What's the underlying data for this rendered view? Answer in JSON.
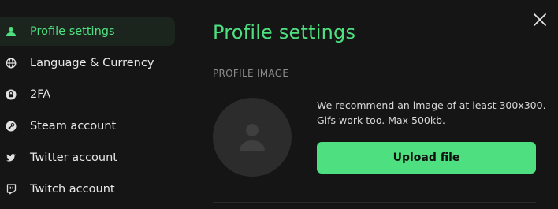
{
  "close": {
    "icon": "close-icon"
  },
  "sidebar": {
    "items": [
      {
        "label": "Profile settings",
        "icon": "user-icon",
        "active": true
      },
      {
        "label": "Language & Currency",
        "icon": "globe-icon",
        "active": false
      },
      {
        "label": "2FA",
        "icon": "lock-icon",
        "active": false
      },
      {
        "label": "Steam account",
        "icon": "steam-icon",
        "active": false
      },
      {
        "label": "Twitter account",
        "icon": "twitter-icon",
        "active": false
      },
      {
        "label": "Twitch account",
        "icon": "twitch-icon",
        "active": false
      }
    ]
  },
  "main": {
    "title": "Profile settings",
    "profile_image": {
      "section_label": "PROFILE IMAGE",
      "avatar_icon": "user-placeholder-icon",
      "hint_line1": "We recommend an image of at least 300x300.",
      "hint_line2": "Gifs work too. Max 500kb.",
      "upload_label": "Upload file"
    }
  },
  "colors": {
    "accent": "#4ee080",
    "background": "#151515",
    "active_item_bg": "#1b251d",
    "avatar_bg": "#2c2c2c"
  }
}
